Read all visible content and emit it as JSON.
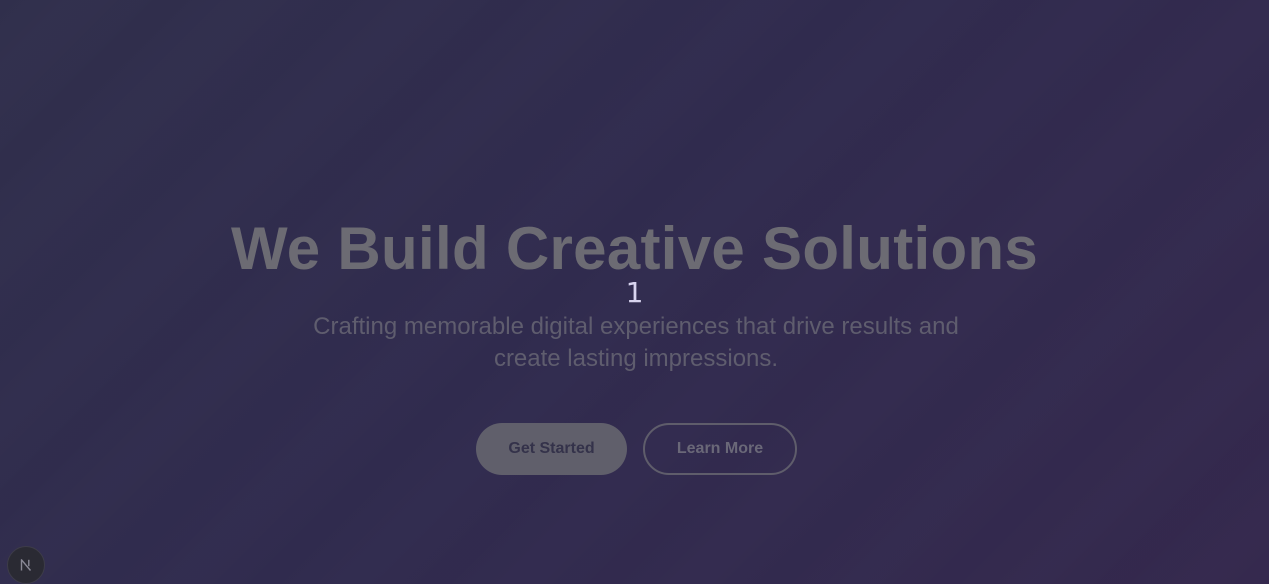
{
  "hero": {
    "title": "We Build Creative Solutions",
    "counter": "1",
    "subtitle": "Crafting memorable digital experiences that drive results and create lasting impressions.",
    "primary_button_label": "Get Started",
    "secondary_button_label": "Learn More"
  },
  "dev_badge": {
    "icon": "nextjs-logo-icon"
  },
  "colors": {
    "background_start": "#302f4c",
    "background_end": "#34284d",
    "title_text": "#6c6b73",
    "counter_text": "#d8d4ef",
    "subtitle_text": "#5f5d6e",
    "primary_button_bg": "#605f6b"
  }
}
